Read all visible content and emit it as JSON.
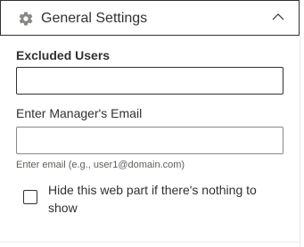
{
  "section": {
    "title": "General Settings",
    "expanded": true,
    "icon": "gear-icon",
    "toggle_icon": "chevron-up-icon"
  },
  "excluded_users": {
    "label": "Excluded Users",
    "value": ""
  },
  "manager_email": {
    "label": "Enter Manager's Email",
    "value": "",
    "hint": "Enter email (e.g., user1@domain.com)"
  },
  "hide_web_part": {
    "label": "Hide this web part if there's nothing to show",
    "checked": false
  }
}
